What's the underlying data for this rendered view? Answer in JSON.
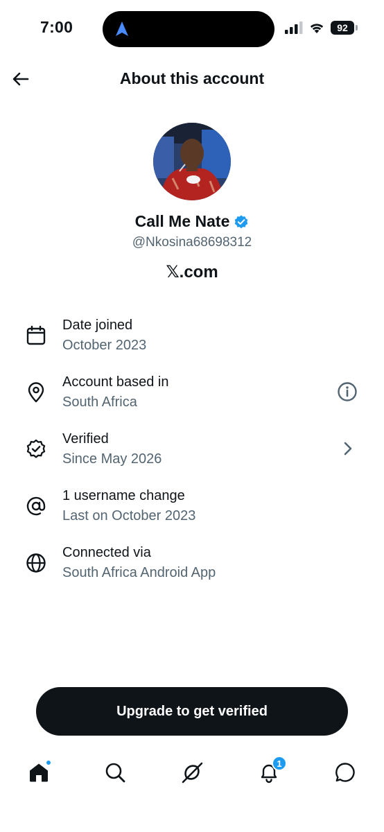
{
  "status_bar": {
    "time": "7:00",
    "battery": "92"
  },
  "header": {
    "title": "About this account"
  },
  "profile": {
    "display_name": "Call Me Nate",
    "handle": "@Nkosina68698312",
    "site": "𝕏.com",
    "verified_color": "#1d9bf0"
  },
  "info": [
    {
      "icon": "calendar-icon",
      "title": "Date joined",
      "subtitle": "October 2023"
    },
    {
      "icon": "location-pin-icon",
      "title": "Account based in",
      "subtitle": "South Africa",
      "action_icon": "info-icon"
    },
    {
      "icon": "verified-badge-icon",
      "title": "Verified",
      "subtitle": "Since May 2026",
      "action_icon": "chevron-right-icon"
    },
    {
      "icon": "at-sign-icon",
      "title": "1 username change",
      "subtitle": "Last on October 2023"
    },
    {
      "icon": "globe-icon",
      "title": "Connected via",
      "subtitle": "South Africa Android App"
    }
  ],
  "upgrade_button": {
    "label": "Upgrade to get verified"
  },
  "bottom_nav": {
    "items": [
      "home-icon",
      "search-icon",
      "grok-icon",
      "notifications-icon",
      "messages-icon"
    ],
    "notification_count": "1"
  },
  "colors": {
    "text": "#0f1419",
    "secondary": "#536471",
    "accent": "#1d9bf0"
  }
}
